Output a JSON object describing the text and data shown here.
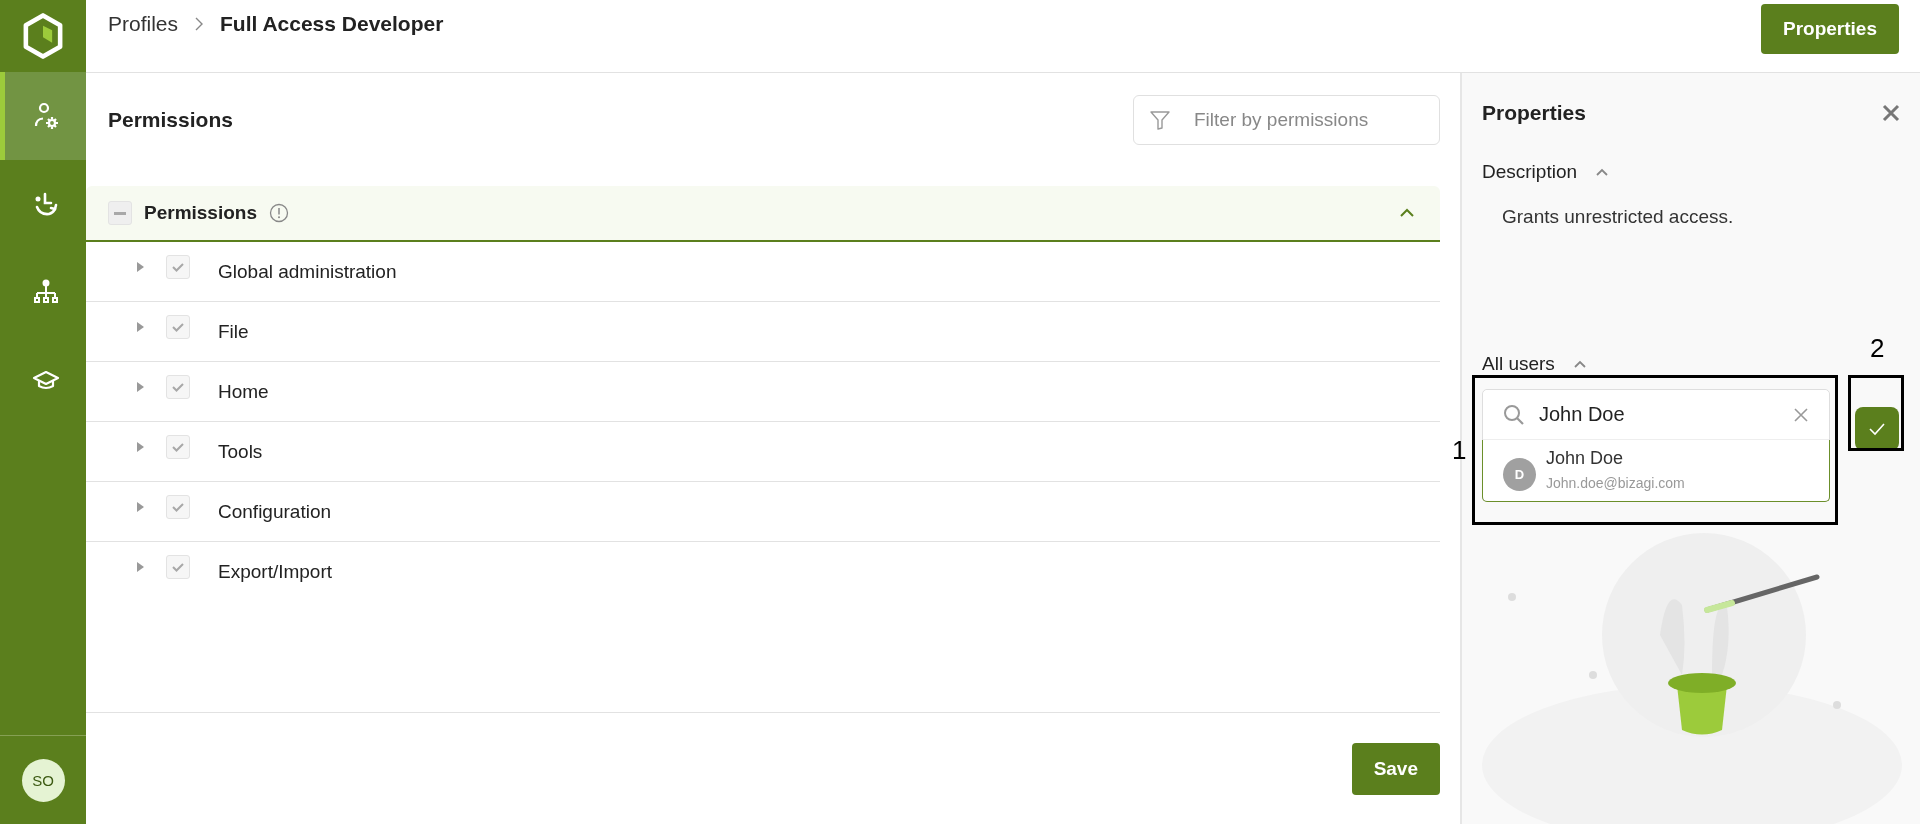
{
  "sidebar": {
    "items": [
      {
        "selected": true
      },
      {
        "selected": false
      },
      {
        "selected": false
      },
      {
        "selected": false
      }
    ],
    "avatar": "SO"
  },
  "breadcrumb": [
    "Profiles",
    "Full Access Developer"
  ],
  "header_button": "Properties",
  "permissions": {
    "title": "Permissions",
    "filter": {
      "placeholder": "Filter by permissions"
    },
    "group": {
      "label": "Permissions",
      "indeterminate": true,
      "expanded": true,
      "items": [
        {
          "label": "Global administration",
          "checked": true,
          "expanded": false
        },
        {
          "label": "File",
          "checked": true,
          "expanded": false
        },
        {
          "label": "Home",
          "checked": true,
          "expanded": false
        },
        {
          "label": "Tools",
          "checked": true,
          "expanded": false
        },
        {
          "label": "Configuration",
          "checked": true,
          "expanded": false
        },
        {
          "label": "Export/Import",
          "checked": true,
          "expanded": false
        }
      ]
    }
  },
  "save_button": "Save",
  "properties": {
    "title": "Properties",
    "description": {
      "label": "Description",
      "expanded": true,
      "text": "Grants unrestricted access."
    },
    "users": {
      "label": "All users",
      "expanded": true,
      "search": {
        "value": "John Doe"
      },
      "results": [
        {
          "initial": "D",
          "name": "John Doe",
          "email": "John.doe@bizagi.com"
        }
      ]
    }
  },
  "annotations": [
    "1",
    "2"
  ]
}
